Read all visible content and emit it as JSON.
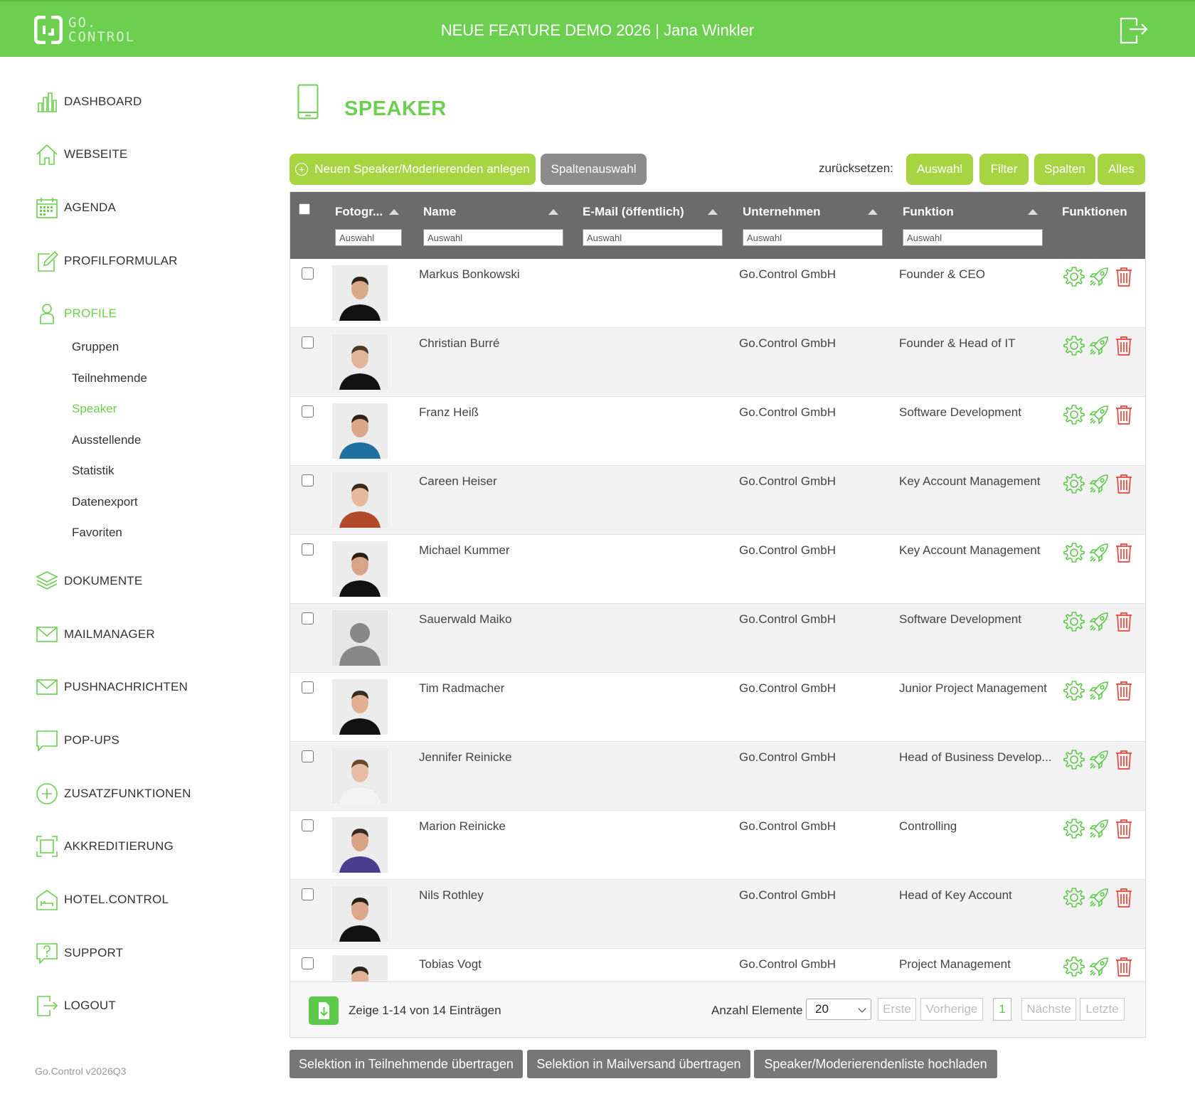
{
  "header": {
    "logo_line1": "GO.",
    "logo_line2": "CONTROL",
    "title": "NEUE FEATURE DEMO 2026 | Jana Winkler",
    "logout_icon": "logout-icon"
  },
  "colors": {
    "brand_green": "#6ccf4f",
    "button_green": "#a6d443",
    "header_grey": "#6b6b6b",
    "delete_red": "#e8453c"
  },
  "sidebar": {
    "items": [
      {
        "label": "DASHBOARD",
        "icon": "bar-chart-icon"
      },
      {
        "label": "WEBSEITE",
        "icon": "home-icon"
      },
      {
        "label": "AGENDA",
        "icon": "calendar-icon"
      },
      {
        "label": "PROFILFORMULAR",
        "icon": "edit-icon"
      },
      {
        "label": "PROFILE",
        "icon": "user-icon"
      },
      {
        "label": "DOKUMENTE",
        "icon": "layers-icon"
      },
      {
        "label": "MAILMANAGER",
        "icon": "mail-icon"
      },
      {
        "label": "PUSHNACHRICHTEN",
        "icon": "mail-icon"
      },
      {
        "label": "POP-UPS",
        "icon": "chat-icon"
      },
      {
        "label": "ZUSATZFUNKTIONEN",
        "icon": "plus-circle-icon"
      },
      {
        "label": "AKKREDITIERUNG",
        "icon": "scan-frame-icon"
      },
      {
        "label": "HOTEL.CONTROL",
        "icon": "hotel-icon"
      },
      {
        "label": "SUPPORT",
        "icon": "help-chat-icon"
      },
      {
        "label": "LOGOUT",
        "icon": "logout-icon"
      }
    ],
    "subitems": [
      "Gruppen",
      "Teilnehmende",
      "Speaker",
      "Ausstellende",
      "Statistik",
      "Datenexport",
      "Favoriten"
    ],
    "version": "Go.Control v2026Q3"
  },
  "page": {
    "title": "SPEAKER",
    "icon": "mobile-phone-icon"
  },
  "toolbar": {
    "new_label": "Neuen Speaker/Moderierenden anlegen",
    "columns_label": "Spaltenauswahl",
    "reset_label": "zurücksetzen:",
    "reset_buttons": [
      "Auswahl",
      "Filter",
      "Spalten",
      "Alles"
    ]
  },
  "table": {
    "columns": [
      "Fotogr...",
      "Name",
      "E-Mail (öffentlich)",
      "Unternehmen",
      "Funktion",
      "Funktionen"
    ],
    "filter_placeholder": "Auswahl",
    "rows": [
      {
        "name": "Markus Bonkowski",
        "email": "",
        "company": "Go.Control GmbH",
        "function": "Founder & CEO"
      },
      {
        "name": "Christian Burré",
        "email": "",
        "company": "Go.Control GmbH",
        "function": "Founder & Head of IT"
      },
      {
        "name": "Franz Heiß",
        "email": "",
        "company": "Go.Control GmbH",
        "function": "Software Development"
      },
      {
        "name": "Careen Heiser",
        "email": "",
        "company": "Go.Control GmbH",
        "function": "Key Account Management"
      },
      {
        "name": "Michael Kummer",
        "email": "",
        "company": "Go.Control GmbH",
        "function": "Key Account Management"
      },
      {
        "name": "Sauerwald Maiko",
        "email": "",
        "company": "Go.Control GmbH",
        "function": "Software Development"
      },
      {
        "name": "Tim Radmacher",
        "email": "",
        "company": "Go.Control GmbH",
        "function": "Junior Project Management"
      },
      {
        "name": "Jennifer Reinicke",
        "email": "",
        "company": "Go.Control GmbH",
        "function": "Head of Business Develop..."
      },
      {
        "name": "Marion Reinicke",
        "email": "",
        "company": "Go.Control GmbH",
        "function": "Controlling"
      },
      {
        "name": "Nils Rothley",
        "email": "",
        "company": "Go.Control GmbH",
        "function": "Head of Key Account"
      },
      {
        "name": "Tobias Vogt",
        "email": "",
        "company": "Go.Control GmbH",
        "function": "Project Management"
      }
    ],
    "footer": {
      "info": "Zeige 1-14 von 14 Einträgen",
      "count_label": "Anzahl Elemente",
      "count_value": "20",
      "pagination": [
        "Erste",
        "Vorherige",
        "1",
        "Nächste",
        "Letzte"
      ]
    }
  },
  "bottom_buttons": [
    "Selektion in Teilnehmende übertragen",
    "Selektion in Mailversand übertragen",
    "Speaker/Moderierendenliste hochladen"
  ]
}
